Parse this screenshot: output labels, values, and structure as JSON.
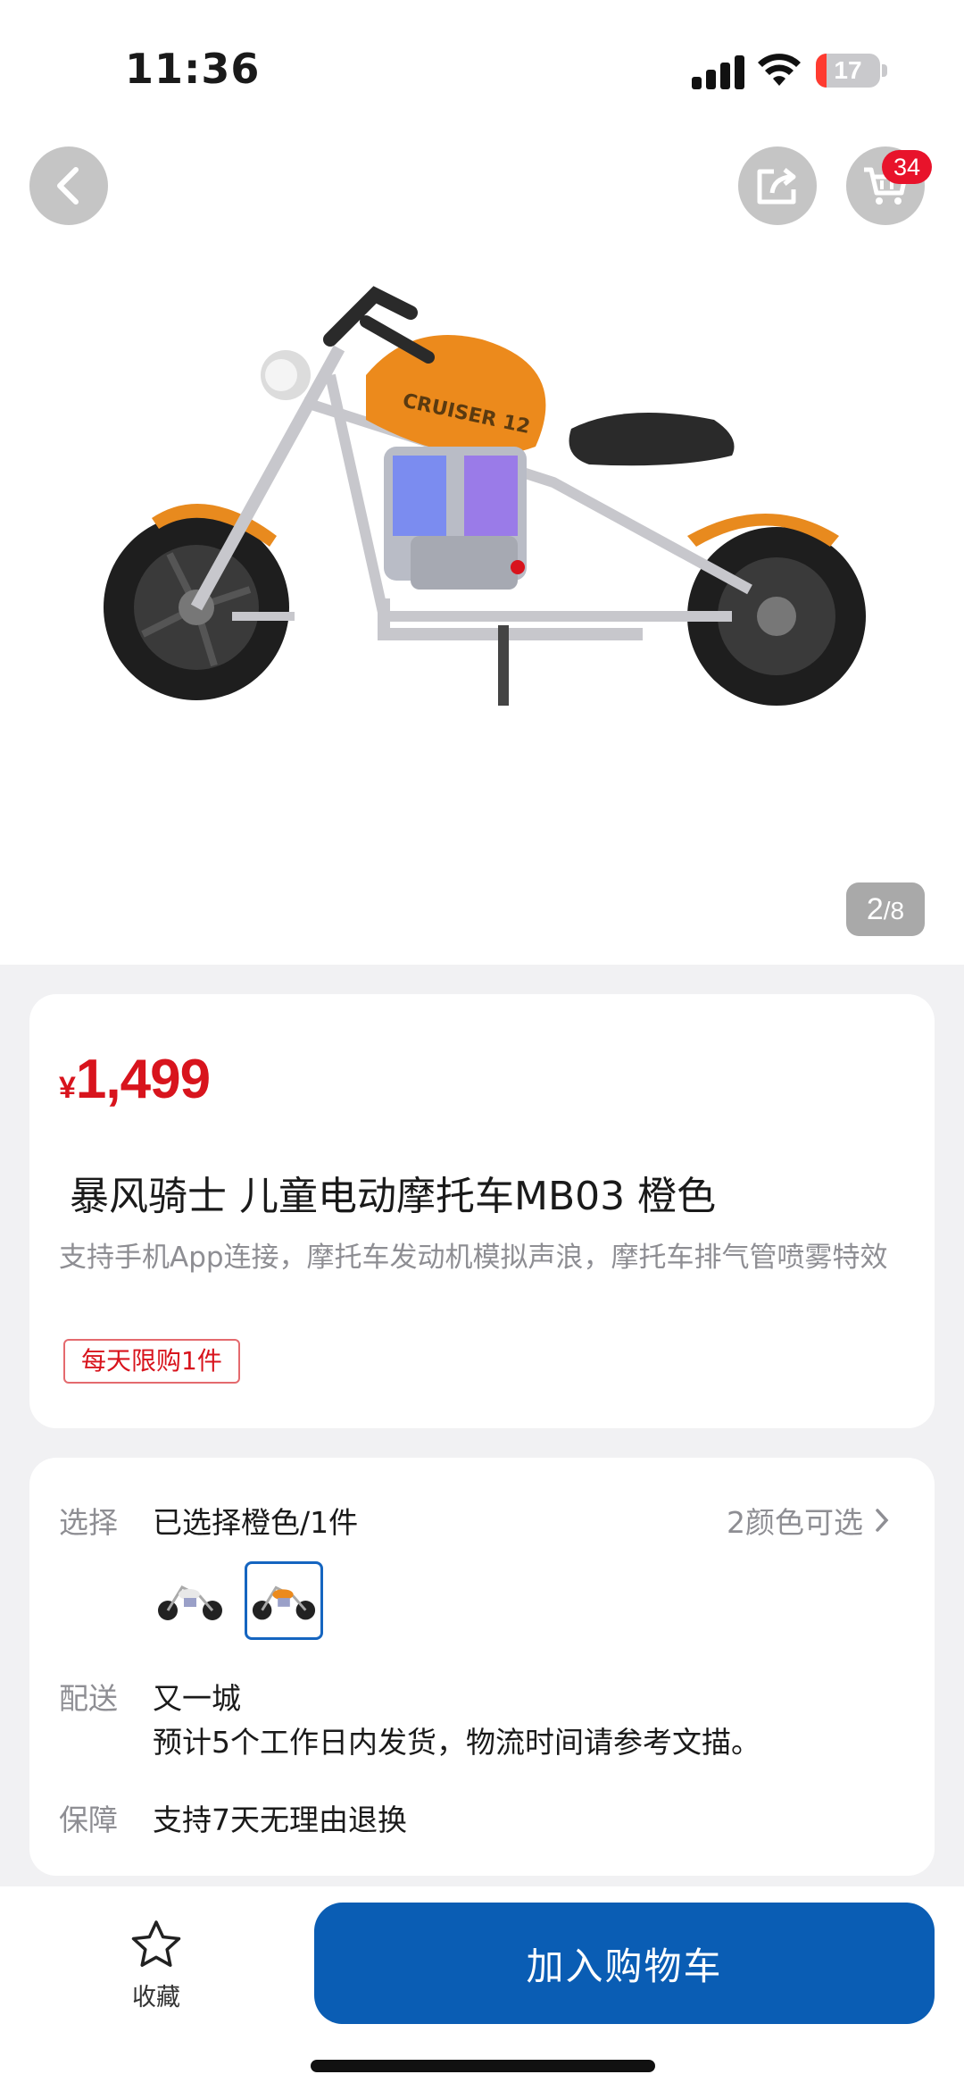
{
  "status_bar": {
    "time": "11:36",
    "battery": "17",
    "battery_level": 0.17
  },
  "header": {
    "back_icon": "chevron-left-icon",
    "share_icon": "share-icon",
    "cart_icon": "cart-icon",
    "cart_count": "34"
  },
  "gallery": {
    "image": "orange-kids-electric-motorcycle",
    "image_text": "CRUISER 12",
    "indicator_current": "2",
    "indicator_total": "/8"
  },
  "product": {
    "price_symbol": "¥",
    "price": "1,499",
    "title": "暴风骑士 儿童电动摩托车MB03  橙色",
    "description": "支持手机App连接，摩托车发动机模拟声浪，摩托车排气管喷雾特效",
    "limit_tag": "每天限购1件"
  },
  "options": {
    "select_label": "选择",
    "select_value": "已选择橙色/1件",
    "colors_available": "2颜色可选",
    "swatches": [
      "white-motorcycle-thumbnail",
      "orange-motorcycle-thumbnail"
    ],
    "delivery_label": "配送",
    "delivery_location": "又一城",
    "delivery_note": "预计5个工作日内发货，物流时间请参考文描。",
    "guarantee_label": "保障",
    "guarantee_value": "支持7天无理由退换"
  },
  "bottom_bar": {
    "favorite_label": "收藏",
    "favorite_icon": "star-icon",
    "add_to_cart": "加入购物车"
  },
  "colors": {
    "accent": "#0a5db4",
    "price": "#d8141d",
    "badge": "#e8132b"
  }
}
